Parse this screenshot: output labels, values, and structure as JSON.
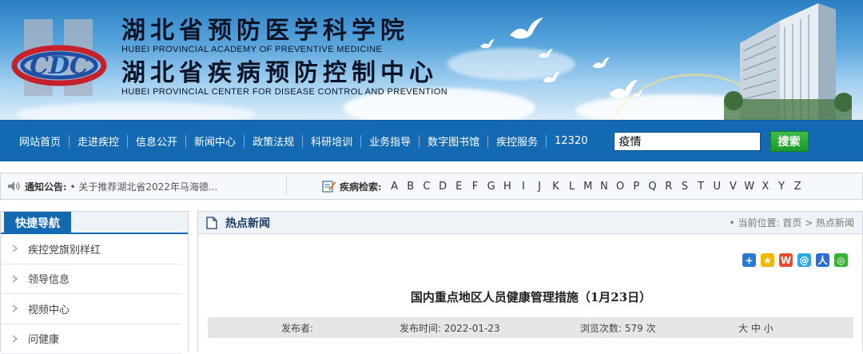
{
  "header": {
    "title_cn_1": "湖北省预防医学科学院",
    "title_en_1": "HUBEI PROVINCIAL ACADEMY OF PREVENTIVE MEDICINE",
    "title_cn_2": "湖北省疾病预防控制中心",
    "title_en_2": "HUBEI PROVINCIAL CENTER FOR DISEASE CONTROL AND PREVENTION",
    "logo_text": "CDC"
  },
  "nav": {
    "items": [
      "网站首页",
      "走进疾控",
      "信息公开",
      "新闻中心",
      "政策法规",
      "科研培训",
      "业务指导",
      "数字图书馆",
      "疾控服务",
      "12320"
    ],
    "search_value": "疫情",
    "search_button": "搜索"
  },
  "notice": {
    "label": "通知公告:",
    "text": "• 关于推荐湖北省2022年马海德...",
    "disease_label": "疾病检索:",
    "letters": [
      "A",
      "B",
      "C",
      "D",
      "E",
      "F",
      "G",
      "H",
      "I",
      "J",
      "K",
      "L",
      "M",
      "N",
      "O",
      "P",
      "Q",
      "R",
      "S",
      "T",
      "U",
      "V",
      "W",
      "X",
      "Y",
      "Z"
    ]
  },
  "sidebar": {
    "title": "快捷导航",
    "items": [
      "疾控党旗别样红",
      "领导信息",
      "视频中心",
      "问健康"
    ]
  },
  "main": {
    "section_title": "热点新闻",
    "breadcrumb": "• 当前位置: 首页 > 热点新闻",
    "article_title": "国内重点地区人员健康管理措施（1月23日）",
    "meta_publisher": "发布者:",
    "meta_date": "发布时间: 2022-01-23",
    "meta_views": "浏览次数: 579 次",
    "font_size_label": "大 中 小"
  },
  "colors": {
    "nav_bg": "#1469b3",
    "search_btn": "#1c9a2a"
  }
}
